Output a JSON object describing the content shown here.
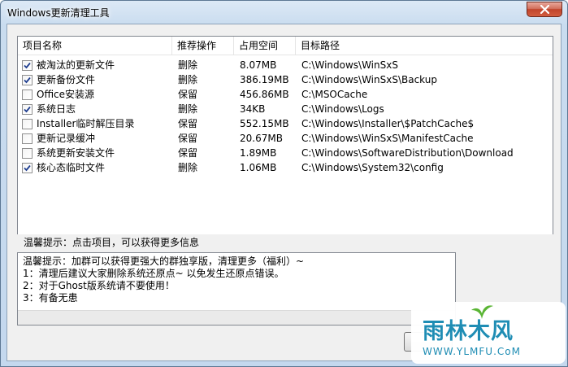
{
  "window": {
    "title": "Windows更新清理工具"
  },
  "list": {
    "columns": [
      "项目名称",
      "推荐操作",
      "占用空间",
      "目标路径"
    ],
    "rows": [
      {
        "checked": true,
        "name": "被淘汰的更新文件",
        "action": "删除",
        "size": "8.07MB",
        "path": "C:\\Windows\\WinSxS"
      },
      {
        "checked": true,
        "name": "更新备份文件",
        "action": "删除",
        "size": "386.19MB",
        "path": "C:\\Windows\\WinSxS\\Backup"
      },
      {
        "checked": false,
        "name": "Office安装源",
        "action": "保留",
        "size": "456.86MB",
        "path": "C:\\MSOCache"
      },
      {
        "checked": true,
        "name": "系统日志",
        "action": "删除",
        "size": "34KB",
        "path": "C:\\Windows\\Logs"
      },
      {
        "checked": false,
        "name": "Installer临时解压目录",
        "action": "保留",
        "size": "552.15MB",
        "path": "C:\\Windows\\Installer\\$PatchCache$"
      },
      {
        "checked": false,
        "name": "更新记录缓冲",
        "action": "保留",
        "size": "20.67MB",
        "path": "C:\\Windows\\WinSxS\\ManifestCache"
      },
      {
        "checked": false,
        "name": "系统更新安装文件",
        "action": "保留",
        "size": "1.89MB",
        "path": "C:\\Windows\\SoftwareDistribution\\Download"
      },
      {
        "checked": true,
        "name": "核心态临时文件",
        "action": "删除",
        "size": "1.06MB",
        "path": "C:\\Windows\\System32\\config"
      }
    ]
  },
  "hint": {
    "text": "温馨提示：点击项目，可以获得更多信息"
  },
  "log": {
    "lines": [
      "温馨提示：加群可以获得更强大的群独享版，清理更多（福利）~",
      "1：清理后建议大家删除系统还原点~ 以免发生还原点错误。",
      "2：对于Ghost版系统请不要使用！",
      "3：有备无患"
    ]
  },
  "watermark": {
    "brand": "雨林木风",
    "url": "WWW.YLMFU.CoM"
  },
  "colors": {
    "brand": "#1f8db4",
    "close": "#c1452c"
  },
  "icons": {
    "close": "close-icon",
    "check": "checkmark-icon"
  }
}
